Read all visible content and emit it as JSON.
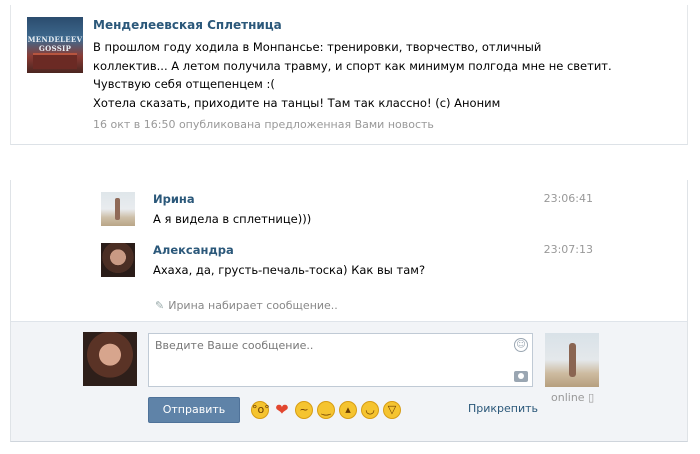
{
  "post": {
    "author": "Менделеевская Сплетница",
    "avatar_text": "MENDELEEV GOSSIP",
    "lines": [
      "В прошлом году ходила в Монпансье: тренировки, творчество, отличный",
      "коллектив... А летом получила травму, и спорт как минимум полгода мне не светит.",
      "Чувствую себя отщепенцем :(",
      "Хотела сказать, приходите на танцы! Там так классно! (с) Аноним"
    ],
    "meta": "16 окт в 16:50 опубликована предложенная Вами новость"
  },
  "messages": [
    {
      "name": "Ирина",
      "time": "23:06:41",
      "text": "А я видела в сплетнице)))"
    },
    {
      "name": "Александра",
      "time": "23:07:13",
      "text": "Ахаха, да, грусть-печаль-тоска) Как вы там?"
    }
  ],
  "typing": "Ирина набирает сообщение..",
  "compose": {
    "placeholder": "Введите Ваше сообщение..",
    "send_label": "Отправить",
    "attach_label": "Прикрепить",
    "online_label": "online"
  },
  "emoji_icons": [
    "scream-emoji-icon",
    "heart-icon",
    "confused-emoji-icon",
    "smile-emoji-icon",
    "angry-emoji-icon",
    "grin-emoji-icon",
    "laugh-emoji-icon"
  ]
}
